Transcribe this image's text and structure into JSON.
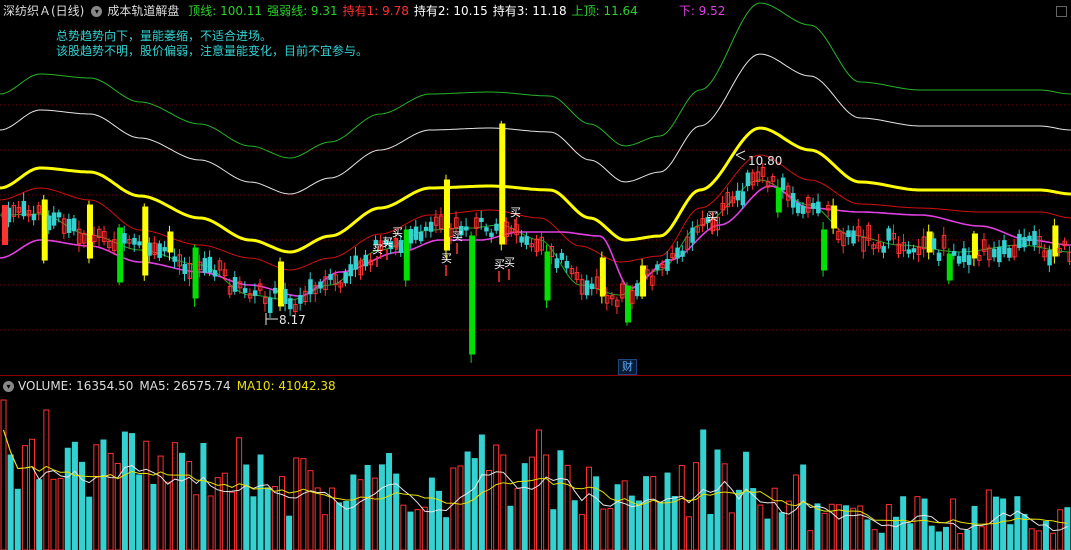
{
  "header": {
    "stock_name": "深纺织Ａ(日线)",
    "indicator_name": "成本轨道解盘",
    "items": [
      {
        "label": "顶线: 100.11",
        "color": "#2bd12b"
      },
      {
        "label": "强弱线: 9.31",
        "color": "#2bd12b"
      },
      {
        "label": "持有1: 9.78",
        "color": "#ff3232"
      },
      {
        "label": "持有2: 10.15",
        "color": "#ffffff"
      },
      {
        "label": "持有3: 11.18",
        "color": "#ffffff"
      },
      {
        "label": "上顶: 11.64",
        "color": "#2bd12b"
      },
      {
        "label": "下: 9.52",
        "color": "#e040e0"
      }
    ]
  },
  "notes": [
    "总势趋势向下，量能萎缩，不适合进场。",
    "该股趋势不明，股价偏弱，注意量能变化，目前不宜参与。"
  ],
  "annotations": {
    "high_label": "10.80",
    "low_label": "8.17",
    "buy_label": "买",
    "finance_badge": "财"
  },
  "volume_header": {
    "items": [
      {
        "label": "VOLUME: 16354.50",
        "color": "#dddddd"
      },
      {
        "label": "MA5: 26575.74",
        "color": "#dddddd"
      },
      {
        "label": "MA10: 41042.38",
        "color": "#e8e000"
      }
    ]
  },
  "colors": {
    "up": "#ff3232",
    "down": "#35d1d1",
    "yellow": "#ffff00",
    "green": "#00e000",
    "magenta": "#e040e0",
    "red_line": "#d01010",
    "white_band": "#e6e6e6",
    "green_band": "#28b428"
  },
  "icons": [
    "dropdown-circle-icon",
    "close-square-icon"
  ]
}
